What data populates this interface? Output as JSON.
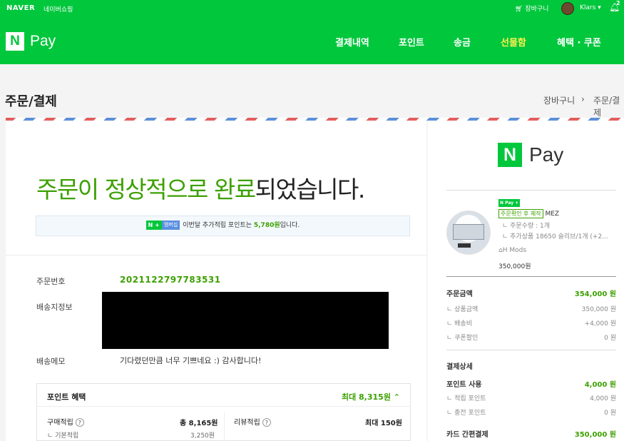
{
  "topbar": {
    "naver": "NAVER",
    "shop": "네이버쇼핑",
    "cart": "장바구니",
    "user": "Klars",
    "bell_count": "2"
  },
  "gnb": {
    "logo_n": "N",
    "logo_pay": "Pay",
    "nav": [
      {
        "label": "결제내역",
        "active": false
      },
      {
        "label": "포인트",
        "active": false
      },
      {
        "label": "송금",
        "active": false
      },
      {
        "label": "선물함",
        "active": true
      },
      {
        "label": "혜택 · 쿠폰",
        "active": false
      }
    ]
  },
  "header": {
    "title": "주문/결제",
    "breadcrumb": [
      "장바구니",
      "주문/결제"
    ],
    "bc_sep": "›"
  },
  "main": {
    "done_green": "주문이 정상적으로 완료",
    "done_rest": "되었습니다.",
    "notice": {
      "badge_n": "N",
      "badge_plus": "+",
      "badge_member": "멤버십",
      "text_pre": "이번달 추가적립 포인트는 ",
      "points": "5,780원",
      "text_post": "입니다."
    },
    "order_no_label": "주문번호",
    "order_no": "2021122797783531",
    "ship_label": "배송지정보",
    "memo_label": "배송메모",
    "memo": "기다렸던만큼 너무 기쁘네요 :) 감사합니다!",
    "point_box": {
      "title": "포인트 혜택",
      "max": "최대 8,315원",
      "chevron": "⌃",
      "buy_label": "구매적립",
      "buy_value": "총 8,165원",
      "basic_label": "ㄴ 기본적립",
      "basic_value": "3,250원",
      "review_label": "리뷰적립",
      "review_value": "최대 150원"
    }
  },
  "side": {
    "logo_n": "N",
    "logo_pay": "Pay",
    "product": {
      "badge": "N Pay +",
      "tag": "주문확인 후 제작",
      "name": "MEZ",
      "qty": "ㄴ 주문수량 : 1개",
      "extra": "ㄴ 추가상품 18650 슬리브/1개 (+2...",
      "store": "H Mods",
      "price": "350,000원"
    },
    "amount": {
      "label": "주문금액",
      "value": "354,000 원",
      "rows": [
        {
          "label": "ㄴ 상품금액",
          "value": "350,000 원"
        },
        {
          "label": "ㄴ 배송비",
          "value": "+4,000 원"
        },
        {
          "label": "ㄴ 쿠폰할인",
          "value": "0 원"
        }
      ]
    },
    "pay_detail": {
      "label": "결제상세",
      "point_use": {
        "label": "포인트 사용",
        "value": "4,000 원"
      },
      "rows": [
        {
          "label": "ㄴ 적립 포인트",
          "value": "4,000 원"
        },
        {
          "label": "ㄴ 충전 포인트",
          "value": "0 원"
        }
      ],
      "card": {
        "label": "카드 간편결제",
        "value": "350,000 원"
      }
    }
  }
}
